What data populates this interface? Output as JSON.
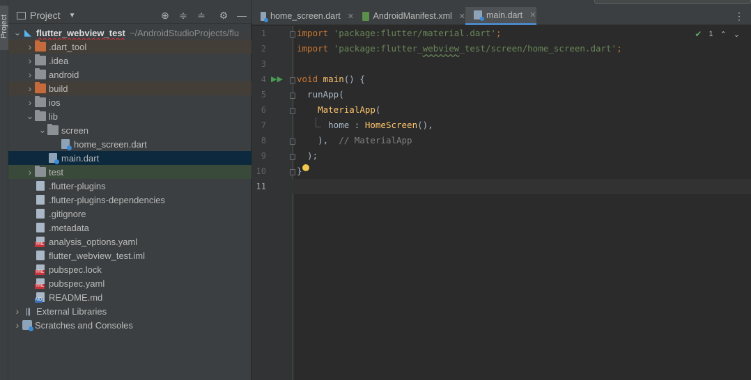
{
  "tool_strip": {
    "project_tab_label": "Project"
  },
  "project_panel": {
    "title": "Project",
    "tree": [
      {
        "label": "flutter_webview_test",
        "path": "~/AndroidStudioProjects/flu",
        "kind": "project",
        "depth": 0,
        "expanded": true
      },
      {
        "label": ".dart_tool",
        "kind": "folder-orange",
        "depth": 1,
        "expanded": false,
        "excluded": true
      },
      {
        "label": ".idea",
        "kind": "folder",
        "depth": 1,
        "expanded": false
      },
      {
        "label": "android",
        "kind": "folder",
        "depth": 1,
        "expanded": false
      },
      {
        "label": "build",
        "kind": "folder-orange",
        "depth": 1,
        "expanded": false,
        "excluded": true
      },
      {
        "label": "ios",
        "kind": "folder",
        "depth": 1,
        "expanded": false
      },
      {
        "label": "lib",
        "kind": "folder",
        "depth": 1,
        "expanded": true
      },
      {
        "label": "screen",
        "kind": "folder",
        "depth": 2,
        "expanded": true
      },
      {
        "label": "home_screen.dart",
        "kind": "dart",
        "depth": 3
      },
      {
        "label": "main.dart",
        "kind": "dart",
        "depth": 2,
        "selected": true
      },
      {
        "label": "test",
        "kind": "folder-test",
        "depth": 1,
        "expanded": false,
        "test": true
      },
      {
        "label": ".flutter-plugins",
        "kind": "file",
        "depth": 1
      },
      {
        "label": ".flutter-plugins-dependencies",
        "kind": "file",
        "depth": 1
      },
      {
        "label": ".gitignore",
        "kind": "file",
        "depth": 1
      },
      {
        "label": ".metadata",
        "kind": "file",
        "depth": 1
      },
      {
        "label": "analysis_options.yaml",
        "kind": "yml",
        "depth": 1
      },
      {
        "label": "flutter_webview_test.iml",
        "kind": "file",
        "depth": 1
      },
      {
        "label": "pubspec.lock",
        "kind": "yml",
        "depth": 1
      },
      {
        "label": "pubspec.yaml",
        "kind": "yml",
        "depth": 1
      },
      {
        "label": "README.md",
        "kind": "md",
        "depth": 1
      },
      {
        "label": "External Libraries",
        "kind": "libraries",
        "depth": 0,
        "expanded": false
      },
      {
        "label": "Scratches and Consoles",
        "kind": "scratches",
        "depth": 0,
        "expanded": false
      }
    ]
  },
  "editor": {
    "tabs": [
      {
        "label": "home_screen.dart",
        "icon": "dart-file-icon",
        "active": false
      },
      {
        "label": "AndroidManifest.xml",
        "icon": "xml-file-icon",
        "active": false
      },
      {
        "label": "main.dart",
        "icon": "dart-file-icon",
        "active": true
      }
    ],
    "inspection_count": "1",
    "line_numbers": [
      "1",
      "2",
      "3",
      "4",
      "5",
      "6",
      "7",
      "8",
      "9",
      "10",
      "11"
    ],
    "current_line": "11",
    "code_lines": [
      [
        {
          "t": "import ",
          "c": "kw"
        },
        {
          "t": "'package:flutter/material.dart'",
          "c": "str"
        },
        {
          "t": ";",
          "c": "kw"
        }
      ],
      [
        {
          "t": "import ",
          "c": "kw"
        },
        {
          "t": "'package:flutter_",
          "c": "str"
        },
        {
          "t": "webview",
          "c": "str wavy"
        },
        {
          "t": "_test/screen/home_screen.dart'",
          "c": "str"
        },
        {
          "t": ";",
          "c": "kw"
        }
      ],
      [],
      [
        {
          "t": "void ",
          "c": "kw"
        },
        {
          "t": "main",
          "c": "cls"
        },
        {
          "t": "() {",
          "c": "plain"
        }
      ],
      [
        {
          "t": "  runApp(",
          "c": "plain"
        }
      ],
      [
        {
          "t": "    ",
          "c": "plain"
        },
        {
          "t": "MaterialApp",
          "c": "cls"
        },
        {
          "t": "(",
          "c": "plain"
        }
      ],
      [
        {
          "t": "      home : ",
          "c": "plain"
        },
        {
          "t": "HomeScreen",
          "c": "cls"
        },
        {
          "t": "(),",
          "c": "plain"
        },
        {
          "t": "",
          "c": "kw"
        }
      ],
      [
        {
          "t": "    ),",
          "c": "plain"
        },
        {
          "t": "  // MaterialApp",
          "c": "cmt"
        }
      ],
      [
        {
          "t": "  );",
          "c": "plain"
        }
      ],
      [
        {
          "t": "}",
          "c": "plain"
        }
      ],
      []
    ]
  }
}
